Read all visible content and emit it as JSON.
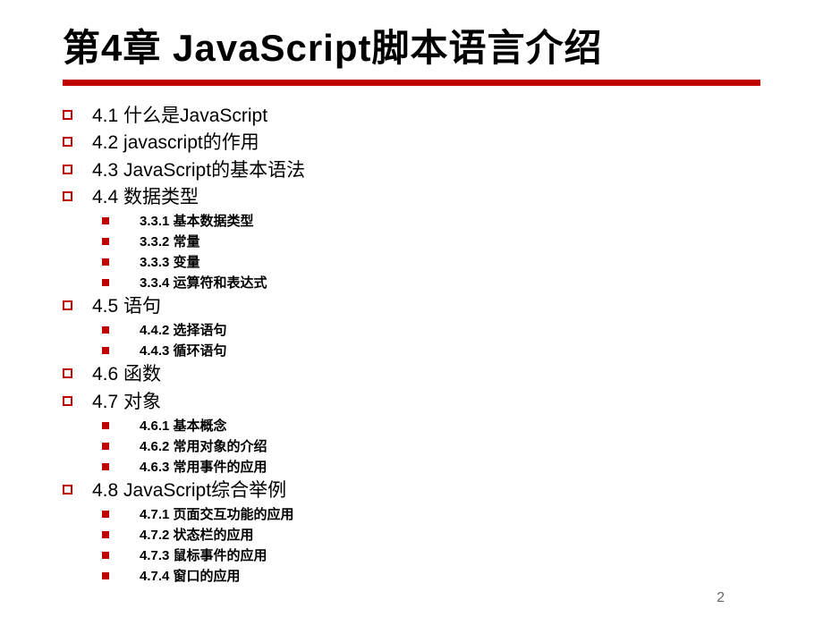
{
  "title": "第4章  JavaScript脚本语言介绍",
  "sections": [
    {
      "level": 1,
      "text": "4.1  什么是JavaScript"
    },
    {
      "level": 1,
      "text": "4.2   javascript的作用"
    },
    {
      "level": 1,
      "text": "4.3  JavaScript的基本语法"
    },
    {
      "level": 1,
      "text": "4.4  数据类型"
    },
    {
      "level": 2,
      "text": "3.3.1  基本数据类型"
    },
    {
      "level": 2,
      "text": "3.3.2  常量"
    },
    {
      "level": 2,
      "text": "3.3.3  变量"
    },
    {
      "level": 2,
      "text": "3.3.4  运算符和表达式"
    },
    {
      "level": 1,
      "text": "4.5  语句"
    },
    {
      "level": 2,
      "text": "4.4.2  选择语句"
    },
    {
      "level": 2,
      "text": "4.4.3  循环语句"
    },
    {
      "level": 1,
      "text": "4.6  函数"
    },
    {
      "level": 1,
      "text": "4.7  对象"
    },
    {
      "level": 2,
      "text": "4.6.1  基本概念"
    },
    {
      "level": 2,
      "text": "4.6.2  常用对象的介绍"
    },
    {
      "level": 2,
      "text": "4.6.3  常用事件的应用"
    },
    {
      "level": 1,
      "text": "4.8  JavaScript综合举例"
    },
    {
      "level": 2,
      "text": "4.7.1  页面交互功能的应用"
    },
    {
      "level": 2,
      "text": "4.7.2  状态栏的应用"
    },
    {
      "level": 2,
      "text": "4.7.3  鼠标事件的应用"
    },
    {
      "level": 2,
      "text": "4.7.4  窗口的应用"
    }
  ],
  "pageNumber": "2"
}
